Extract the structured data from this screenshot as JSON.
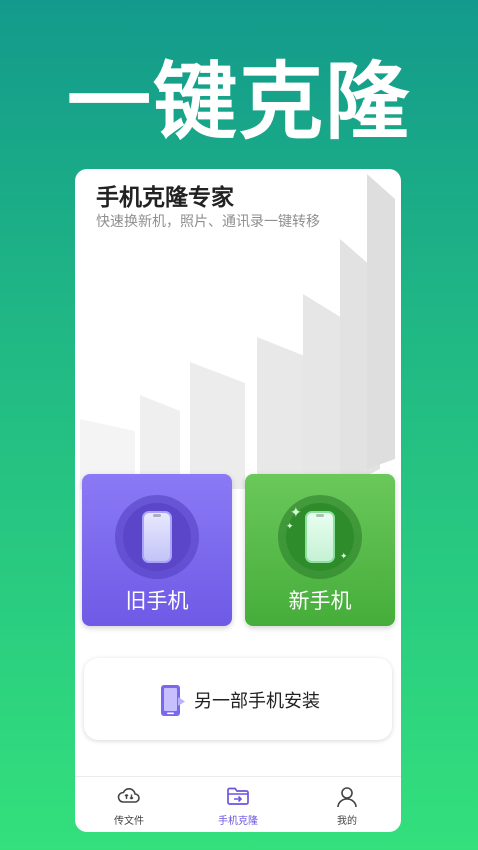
{
  "hero": {
    "title": "一键克隆"
  },
  "card": {
    "title": "手机克隆专家",
    "subtitle": "快速换新机，照片、通讯录一键转移"
  },
  "roles": {
    "old_phone": "旧手机",
    "new_phone": "新手机"
  },
  "install": {
    "label": "另一部手机安装"
  },
  "tabbar": {
    "items": [
      {
        "label": "传文件",
        "icon": "cloud-transfer-icon",
        "active": false
      },
      {
        "label": "手机克隆",
        "icon": "folder-transfer-icon",
        "active": true
      },
      {
        "label": "我的",
        "icon": "user-icon",
        "active": false
      }
    ]
  },
  "colors": {
    "accent": "#6a55e0",
    "old_phone": "#7a68ee",
    "new_phone": "#55b947",
    "background_top": "#139a8c",
    "background_bottom": "#33e07c"
  }
}
